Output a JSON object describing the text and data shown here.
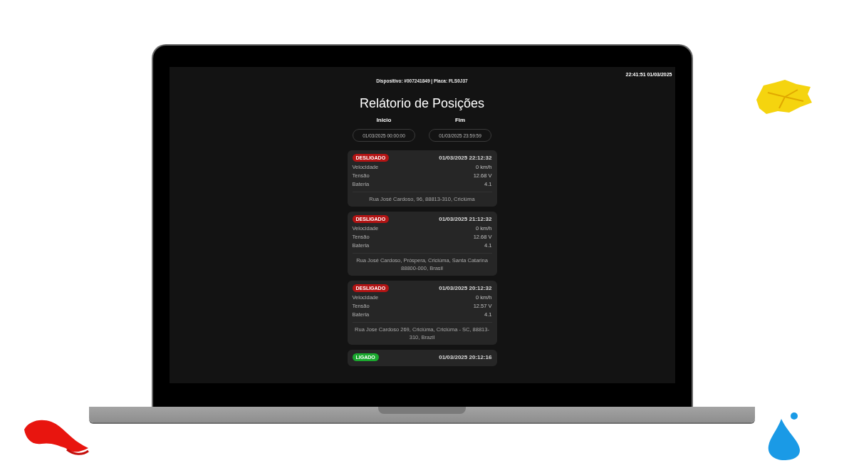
{
  "screen": {
    "clock": "22:41:51 01/03/2025",
    "device_line": "Dispositivo: #007241849 | Placa: FLS0J37",
    "title": "Relátorio de Posições",
    "range": [
      {
        "label": "Inicio",
        "value": "01/03/2025 00:00:00"
      },
      {
        "label": "Fim",
        "value": "01/03/2025 23:59:59"
      }
    ],
    "positions": [
      {
        "status": "DESLIGADO",
        "kind": "off",
        "time": "01/03/2025 22:12:32",
        "fields": [
          {
            "label": "Velocidade",
            "value": "0 km/h"
          },
          {
            "label": "Tensão",
            "value": "12.68 V"
          },
          {
            "label": "Bateria",
            "value": "4.1"
          }
        ],
        "address": "Rua José Cardoso, 96, 88813-310, Criciúma"
      },
      {
        "status": "DESLIGADO",
        "kind": "off",
        "time": "01/03/2025 21:12:32",
        "fields": [
          {
            "label": "Velocidade",
            "value": "0 km/h"
          },
          {
            "label": "Tensão",
            "value": "12.68 V"
          },
          {
            "label": "Bateria",
            "value": "4.1"
          }
        ],
        "address": "Rua José Cardoso, Próspera, Criciúma, Santa Catarina 88800-000, Brasil"
      },
      {
        "status": "DESLIGADO",
        "kind": "off",
        "time": "01/03/2025 20:12:32",
        "fields": [
          {
            "label": "Velocidade",
            "value": "0 km/h"
          },
          {
            "label": "Tensão",
            "value": "12.57 V"
          },
          {
            "label": "Bateria",
            "value": "4.1"
          }
        ],
        "address": "Rua Jose Cardoso 269, Criciúma, Criciúma - SC, 88813-310, Brazil"
      },
      {
        "status": "LIGADO",
        "kind": "on",
        "time": "01/03/2025 20:12:16"
      }
    ]
  }
}
